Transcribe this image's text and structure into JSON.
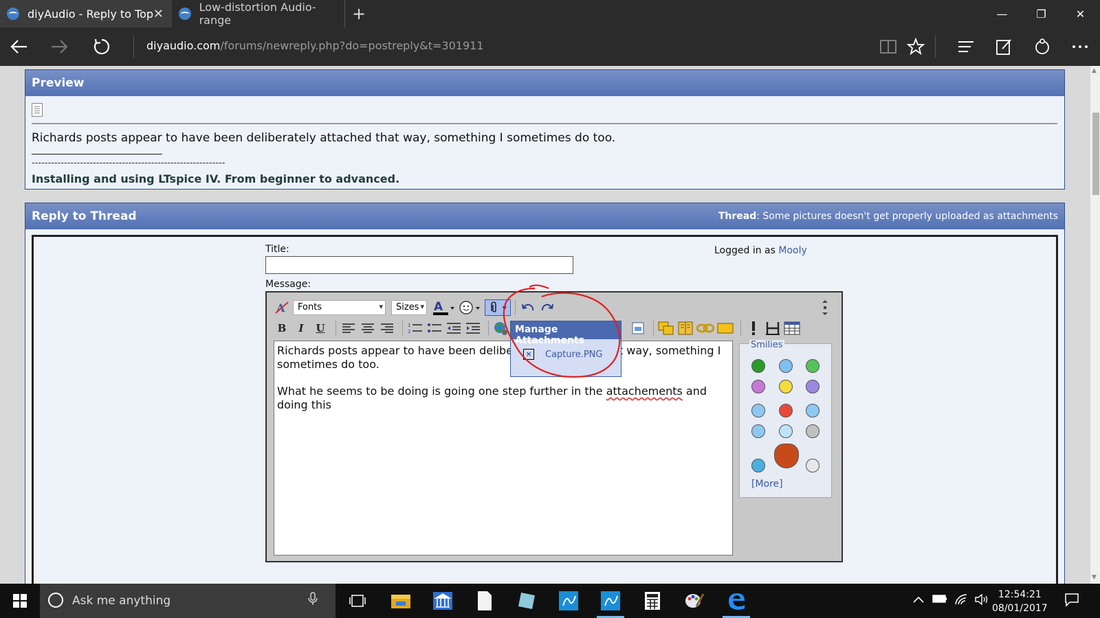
{
  "browser": {
    "tabs": [
      {
        "label": "diyAudio - Reply to Top",
        "close": "✕"
      },
      {
        "label": "Low-distortion Audio-range"
      }
    ],
    "new_tab": "+",
    "window_controls": {
      "minimize": "—",
      "restore": "❐",
      "close": "✕"
    },
    "url": {
      "host": "diyaudio.com",
      "path": "/forums/newreply.php?do=postreply&t=301911"
    }
  },
  "preview": {
    "heading": "Preview",
    "text": "Richards posts appear to have been deliberately attached that way, something I sometimes do too.",
    "dashes": "------------------------------------------------------------",
    "signature_link": "Installing and using LTspice IV. From beginner to advanced."
  },
  "reply": {
    "heading": "Reply to Thread",
    "thread_label": "Thread",
    "thread_title": ": Some pictures doesn't get properly uploaded as attachments",
    "title_label": "Title:",
    "logged_in_text": "Logged in as",
    "username": "Mooly",
    "message_label": "Message:"
  },
  "editor": {
    "font_select": "Fonts",
    "size_select": "Sizes",
    "bold": "B",
    "italic": "I",
    "underline": "U",
    "attach_icon": "paperclip-icon",
    "message_line1": "Richards posts appear to have been deliberately attached that way, something I sometimes do too.",
    "message_line2_a": "What he seems to be doing is going one step further in the ",
    "message_line2_misspelled": "attachements",
    "message_line2_b": " and doing this"
  },
  "attachments_popup": {
    "heading": "Manage Attachments",
    "file": "Capture.PNG"
  },
  "smilies": {
    "legend": "Smilies",
    "more": "[More]"
  },
  "taskbar": {
    "search_placeholder": "Ask me anything",
    "time": "12:54:21",
    "date": "08/01/2017"
  },
  "colors": {
    "panel_header": "#5371b4",
    "link": "#3a5ba0",
    "annotation": "#e02020"
  }
}
